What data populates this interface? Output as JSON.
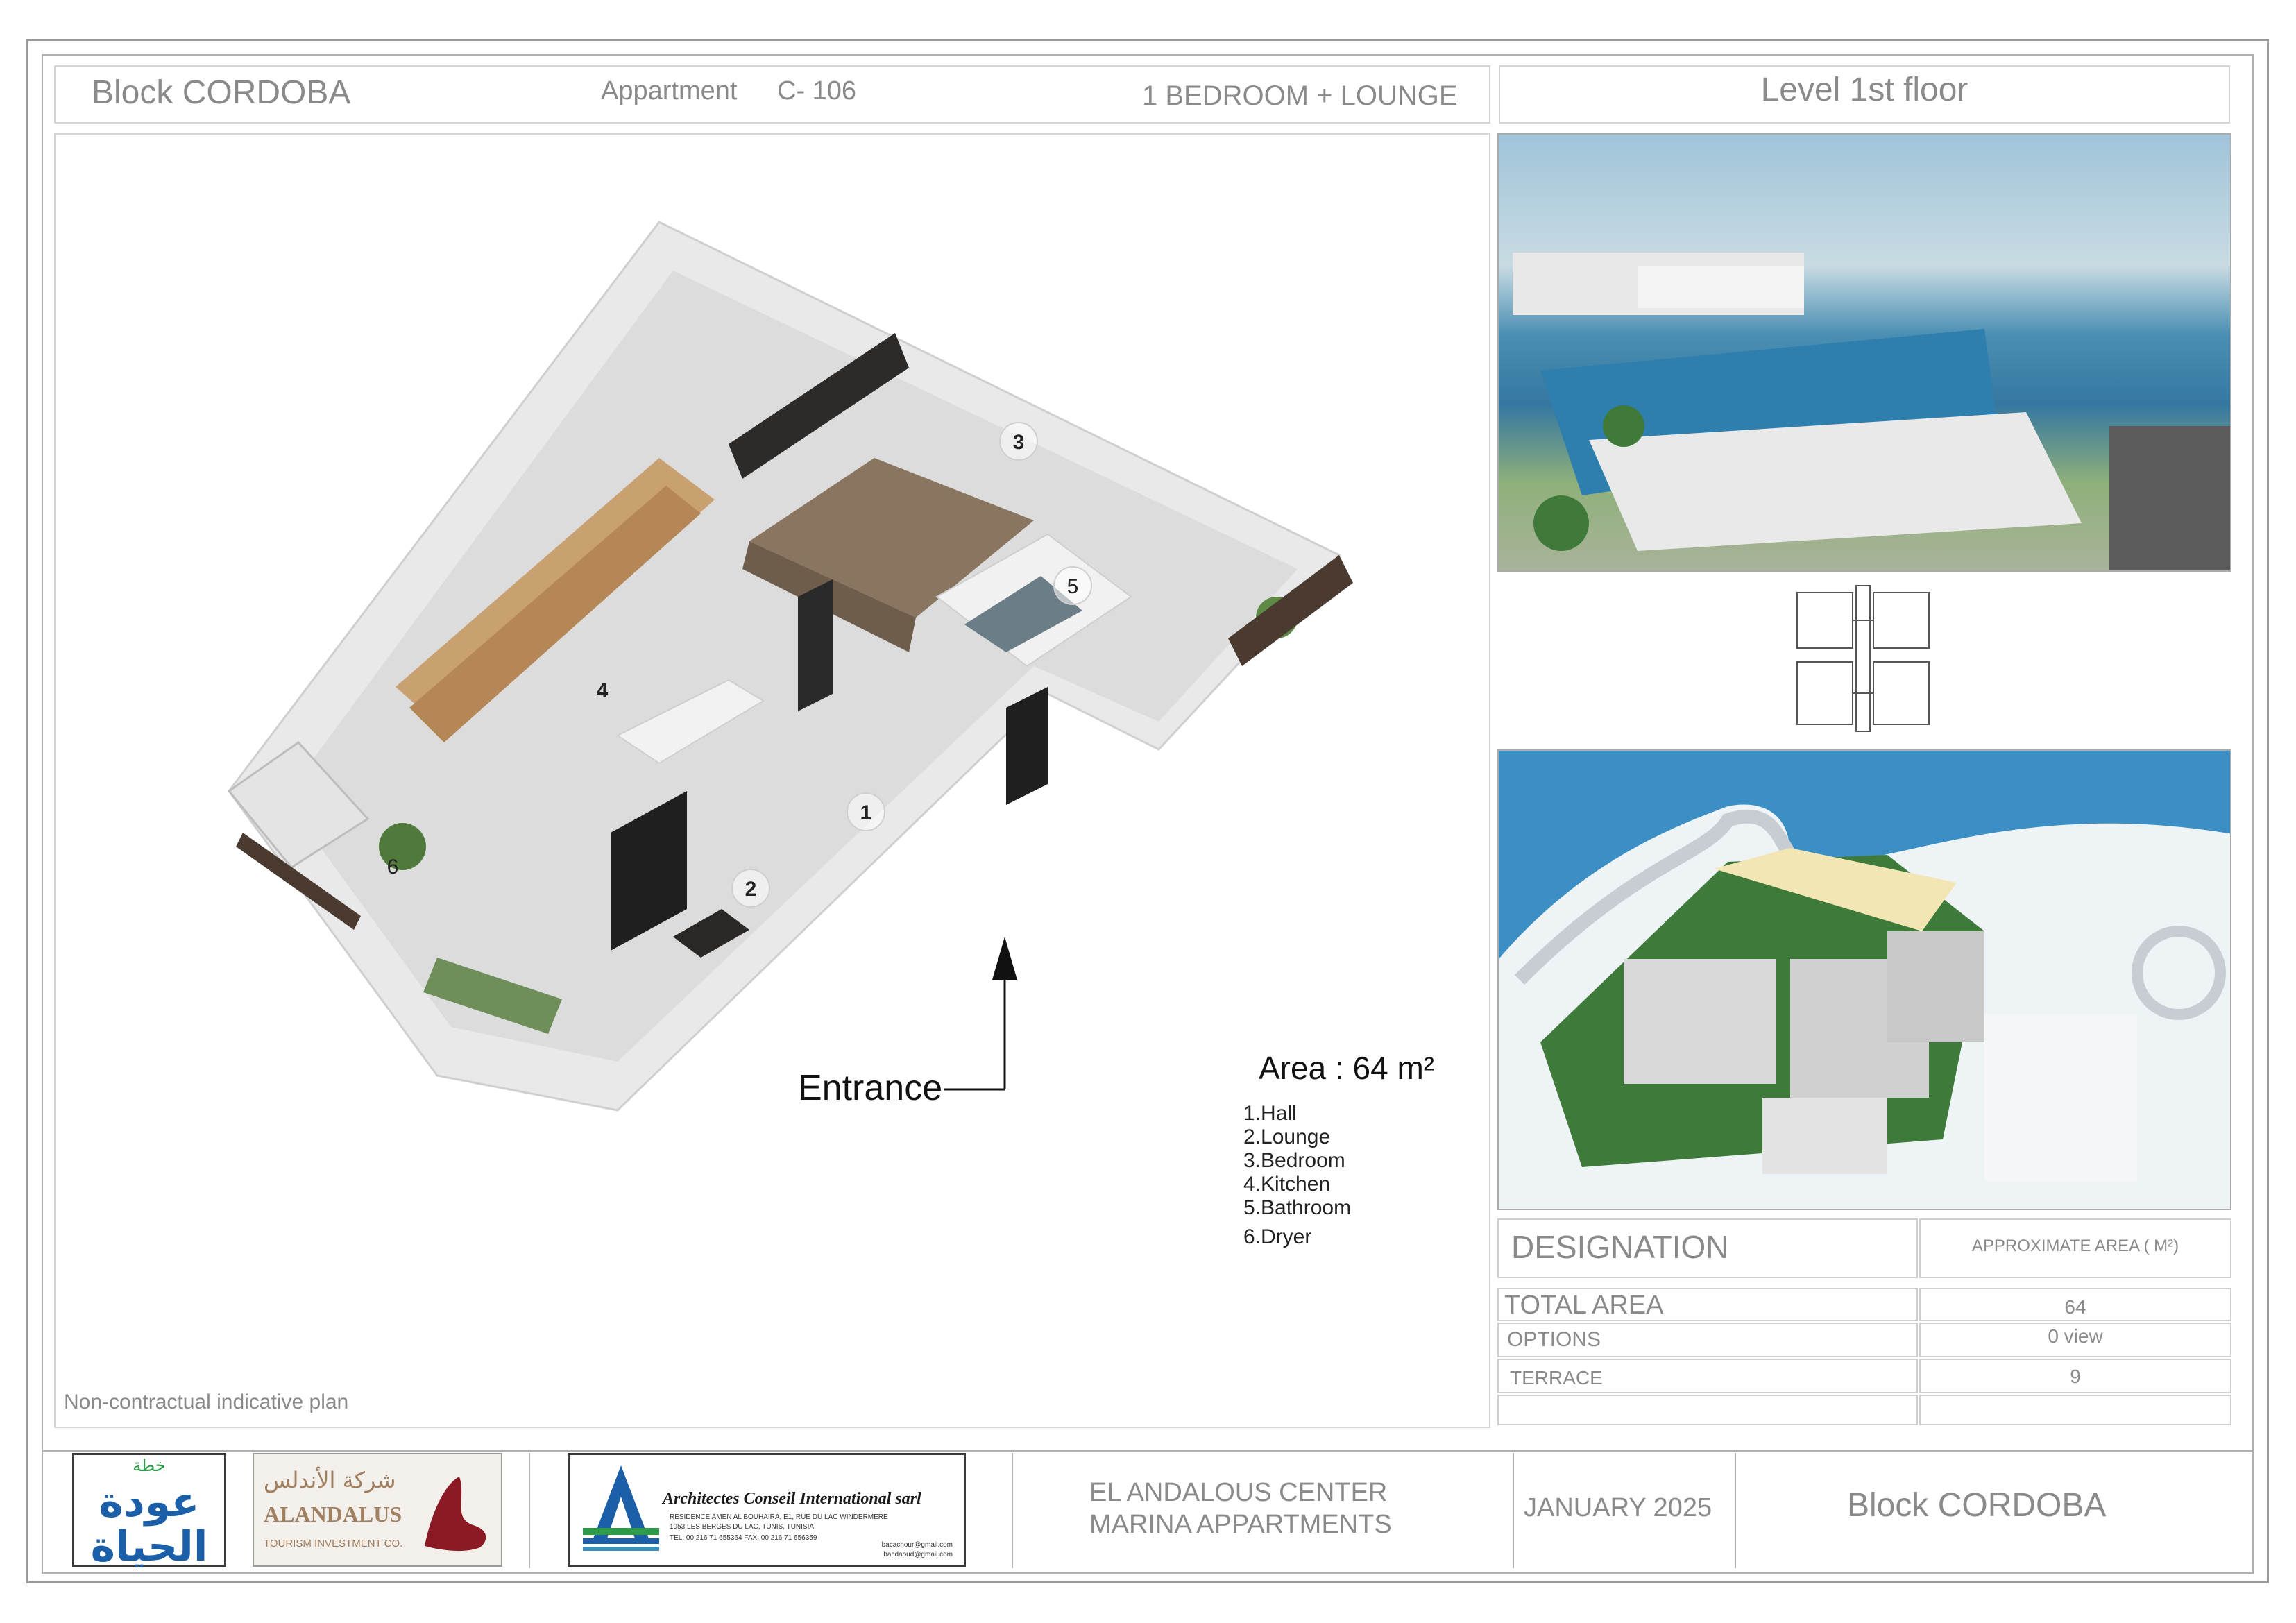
{
  "header": {
    "block": "Block CORDOBA",
    "apartment_label": "Appartment",
    "apartment_code": "C- 106",
    "type": "1 BEDROOM  + LOUNGE",
    "level": "Level 1st floor"
  },
  "plan": {
    "rooms": [
      {
        "num": "1",
        "name": "Hall"
      },
      {
        "num": "2",
        "name": "Lounge"
      },
      {
        "num": "3",
        "name": "Bedroom"
      },
      {
        "num": "4",
        "name": "Kitchen"
      },
      {
        "num": "5",
        "name": "Bathroom"
      },
      {
        "num": "6",
        "name": "Dryer"
      }
    ],
    "entrance": "Entrance",
    "area": "Area : 64 m²",
    "note": "Non-contractual indicative plan"
  },
  "table": {
    "col1": "DESIGNATION",
    "col2": "APPROXIMATE AREA  ( M²)",
    "rows": [
      {
        "label": "TOTAL AREA",
        "value": "64"
      },
      {
        "label": "OPTIONS",
        "value": "0 view"
      },
      {
        "label": "TERRACE",
        "value": "9"
      }
    ]
  },
  "footer": {
    "logo1": "عودة الحياة",
    "logo1_top": "خطة",
    "logo2_ar": "شركة الأندلس",
    "logo2_en": "ALANDALUS",
    "logo2_sub": "TOURISM INVESTMENT CO.",
    "architect": "Architectes  Conseil  International sarl",
    "architect_addr1": "RESIDENCE AMEN AL BOUHAIRA, E1, RUE DU LAC WINDERMERE",
    "architect_addr2": "1053 LES BERGES DU LAC, TUNIS, TUNISIA",
    "architect_tel": "TEL: 00 216 71 655364   FAX: 00 216 71 656359",
    "architect_mail1": "bacachour@gmail.com",
    "architect_mail2": "bacdaoud@gmail.com",
    "project_line1": "EL ANDALOUS CENTER",
    "project_line2": "MARINA APPARTMENTS",
    "date": "JANUARY  2025",
    "block": "Block  CORDOBA"
  },
  "colors": {
    "frame": "#9a9a9a",
    "text": "#8a8a8a",
    "logo_blue": "#1b5fa8",
    "logo_green": "#2f9a4a",
    "logo_red": "#8c1a24",
    "sea": "#3d8fc0"
  }
}
